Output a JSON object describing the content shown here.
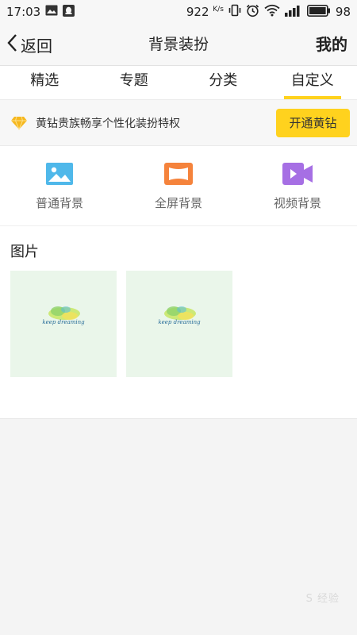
{
  "status_bar": {
    "time": "17:03",
    "net_speed": "922",
    "net_unit": "K/s",
    "battery": "98"
  },
  "nav": {
    "back_label": "返回",
    "title": "背景装扮",
    "right_label": "我的"
  },
  "tabs": [
    {
      "label": "精选"
    },
    {
      "label": "专题"
    },
    {
      "label": "分类"
    },
    {
      "label": "自定义",
      "active": true
    }
  ],
  "vip_banner": {
    "text": "黄钻贵族畅享个性化装扮特权",
    "button": "开通黄钻"
  },
  "options": [
    {
      "label": "普通背景",
      "icon": "image-icon",
      "color": "#4fb8ea"
    },
    {
      "label": "全屏背景",
      "icon": "fullscreen-icon",
      "color": "#f5833c"
    },
    {
      "label": "视频背景",
      "icon": "video-camera-icon",
      "color": "#a66fe4"
    }
  ],
  "images_section": {
    "title": "图片",
    "items": [
      {
        "caption": "keep dreaming"
      },
      {
        "caption": "keep dreaming"
      }
    ]
  },
  "watermark": "S 经验"
}
